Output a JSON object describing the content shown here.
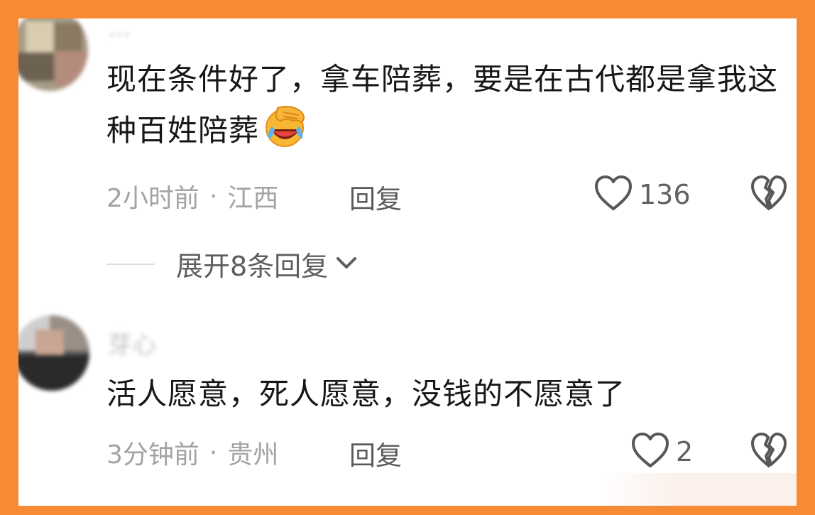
{
  "comments": [
    {
      "username": "...",
      "text": "现在条件好了，拿车陪葬，要是在古代都是拿我这种百姓陪葬",
      "emoji": "facepalm-laughing-emoji",
      "time": "2小时前",
      "separator": "·",
      "location": "江西",
      "reply_label": "回复",
      "likes": "136",
      "expand_label": "展开8条回复"
    },
    {
      "username": "芽心",
      "text": "活人愿意，死人愿意，没钱的不愿意了",
      "time": "3分钟前",
      "separator": "·",
      "location": "贵州",
      "reply_label": "回复",
      "likes": "2"
    }
  ],
  "icons": {
    "like": "heart-outline-icon",
    "dislike": "broken-heart-icon",
    "expand": "chevron-down-icon"
  },
  "colors": {
    "frame": "#f68a35",
    "text": "#171717",
    "meta": "#a3a3a3"
  }
}
